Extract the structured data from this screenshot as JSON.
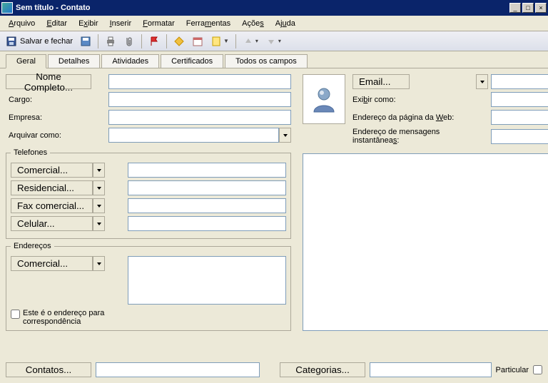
{
  "window": {
    "title": "Sem título - Contato"
  },
  "menu": {
    "arquivo": "Arquivo",
    "editar": "Editar",
    "exibir": "Exibir",
    "inserir": "Inserir",
    "formatar": "Formatar",
    "ferramentas": "Ferramentas",
    "acoes": "Ações",
    "ajuda": "Ajuda"
  },
  "toolbar": {
    "save_close": "Salvar e fechar"
  },
  "tabs": {
    "geral": "Geral",
    "detalhes": "Detalhes",
    "atividades": "Atividades",
    "certificados": "Certificados",
    "todos": "Todos os campos"
  },
  "labels": {
    "nome_completo": "Nome Completo...",
    "cargo": "Cargo:",
    "empresa": "Empresa:",
    "arquivar_como": "Arquivar como:",
    "telefones": "Telefones",
    "comercial": "Comercial...",
    "residencial": "Residencial...",
    "fax_comercial": "Fax comercial...",
    "celular": "Celular...",
    "enderecos": "Endereços",
    "end_comercial": "Comercial...",
    "end_corresp": "Este é o endereço para correspondência",
    "email": "Email...",
    "exibir_como": "Exibir como:",
    "web": "Endereço da página da Web:",
    "im": "Endereço de mensagens instantâneas:",
    "contatos": "Contatos...",
    "categorias": "Categorias...",
    "particular": "Particular"
  },
  "values": {
    "nome_completo": "",
    "cargo": "",
    "empresa": "",
    "arquivar_como": "",
    "tel_comercial": "",
    "tel_residencial": "",
    "tel_fax": "",
    "tel_celular": "",
    "end_comercial": "",
    "email": "",
    "exibir_como": "",
    "web": "",
    "im": "",
    "notes": "",
    "contatos": "",
    "categorias": ""
  }
}
